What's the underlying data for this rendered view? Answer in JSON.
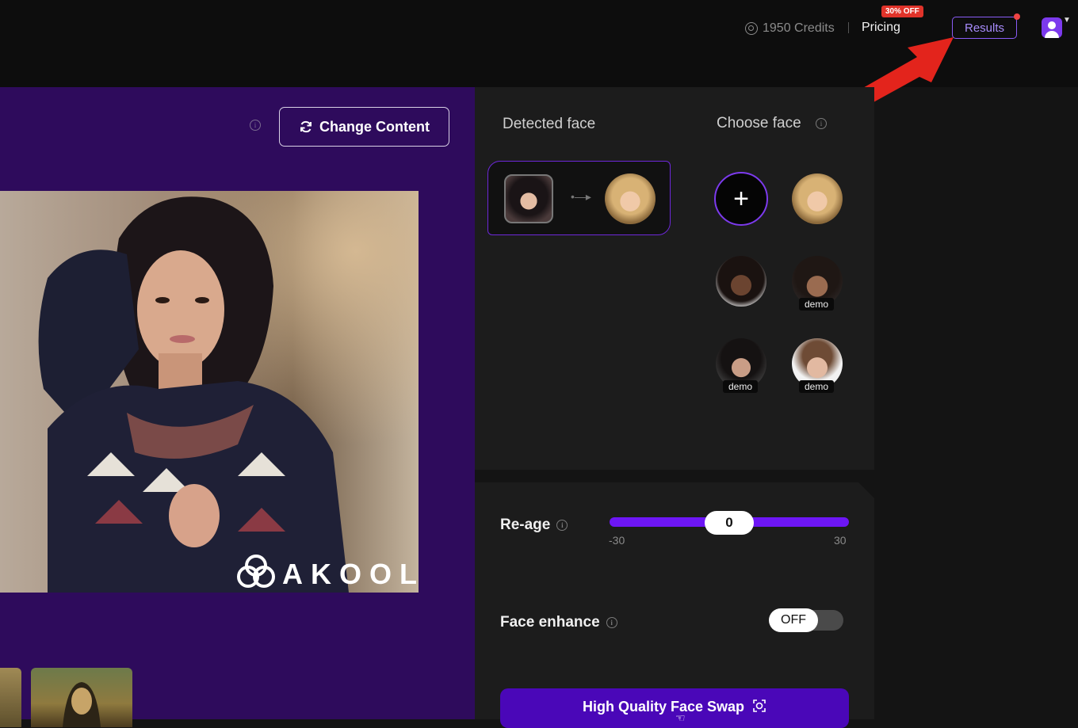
{
  "header": {
    "credits_text": "1950 Credits",
    "pricing_label": "Pricing",
    "discount_badge": "30% OFF",
    "results_label": "Results"
  },
  "left_panel": {
    "change_content_label": "Change Content",
    "watermark_text": "AKOOL"
  },
  "face_panel": {
    "detected_title": "Detected face",
    "choose_title": "Choose face",
    "add_face_symbol": "+",
    "faces": [
      {
        "style": "blonde",
        "tag": ""
      },
      {
        "style": "curly",
        "tag": ""
      },
      {
        "style": "brown",
        "tag": "demo"
      },
      {
        "style": "gray-f",
        "tag": "demo"
      },
      {
        "style": "man",
        "tag": "demo"
      }
    ]
  },
  "settings": {
    "reage_label": "Re-age",
    "reage_value": "0",
    "reage_min": "-30",
    "reage_max": "30",
    "face_enhance_label": "Face enhance",
    "face_enhance_state": "OFF",
    "swap_button_label": "High Quality Face Swap"
  },
  "colors": {
    "accent": "#6d16f5",
    "panel_purple": "#2e0b5c",
    "badge_red": "#e0332a"
  },
  "icons": [
    "coin-icon",
    "refresh-icon",
    "info-icon",
    "plus-icon",
    "face-scan-icon",
    "user-avatar-icon",
    "chevron-down-icon",
    "red-arrow-annotation"
  ]
}
